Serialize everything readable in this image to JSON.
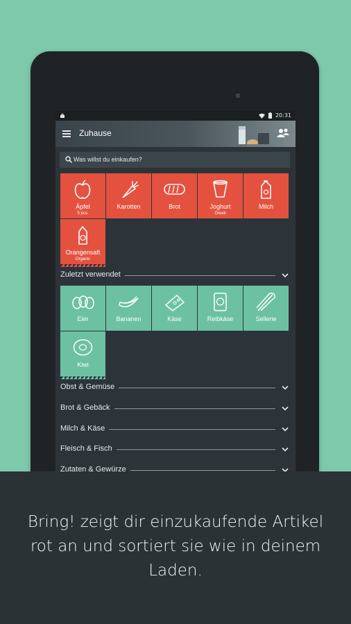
{
  "status_bar": {
    "time": "20:31"
  },
  "app_bar": {
    "title": "Zuhause"
  },
  "search": {
    "placeholder": "Was willst du einkaufen?"
  },
  "shopping_list": [
    {
      "label": "Äpfel",
      "sub": "5 pcs.",
      "icon": "apple-icon"
    },
    {
      "label": "Karotten",
      "sub": "",
      "icon": "carrot-icon"
    },
    {
      "label": "Brot",
      "sub": "",
      "icon": "bread-icon"
    },
    {
      "label": "Joghurt",
      "sub": "Greek",
      "icon": "yogurt-icon"
    },
    {
      "label": "Milch",
      "sub": "",
      "icon": "milk-carton-icon"
    },
    {
      "label": "Orangensaft",
      "sub": "Organic",
      "icon": "juice-carton-icon"
    }
  ],
  "recent": {
    "title": "Zuletzt verwendet",
    "items": [
      {
        "label": "Eier",
        "icon": "eggs-icon"
      },
      {
        "label": "Bananen",
        "icon": "banana-icon"
      },
      {
        "label": "Käse",
        "icon": "cheese-icon"
      },
      {
        "label": "Reibkäse",
        "icon": "grated-cheese-icon"
      },
      {
        "label": "Sellerie",
        "icon": "celery-icon"
      },
      {
        "label": "Kiwi",
        "icon": "kiwi-icon"
      }
    ]
  },
  "categories": [
    "Obst & Gemüse",
    "Brot & Gebäck",
    "Milch & Käse",
    "Fleisch & Fisch",
    "Zutaten & Gewürze"
  ],
  "caption": "Bring! zeigt dir einzukaufende Artikel rot an und sortiert sie wie in deinem Laden.",
  "colors": {
    "background": "#7ec8ac",
    "tile_red": "#e4523f",
    "tile_green": "#6cc1a3",
    "app_background": "#2c343a"
  }
}
